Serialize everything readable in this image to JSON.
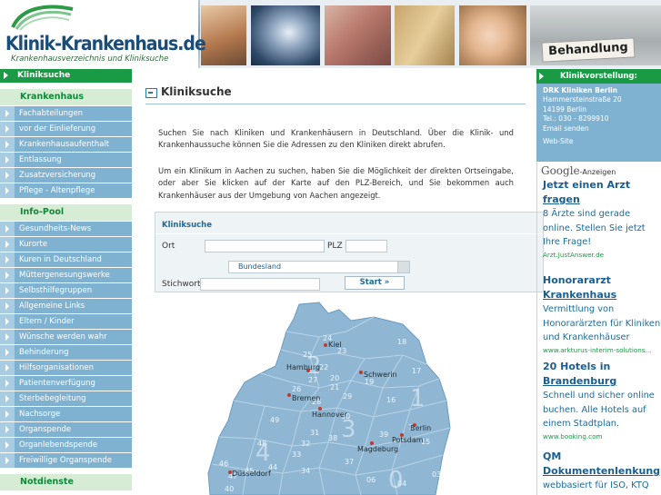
{
  "header": {
    "logo_title": "Klinik-Krankenhaus.de",
    "logo_subtitle": "Krankenhausverzeichnis und Kliniksuche",
    "banner_sign": "Behandlung"
  },
  "sidebar": {
    "active_item": "Kliniksuche",
    "sections": [
      {
        "title": "Krankenhaus",
        "items": [
          "Fachabteilungen",
          "vor der Einlieferung",
          "Krankenhausaufenthalt",
          "Entlassung",
          "Zusatzversicherung",
          "Pflege - Altenpflege"
        ]
      },
      {
        "title": "Info-Pool",
        "items": [
          "Gesundheits-News",
          "Kurorte",
          "Kuren in Deutschland",
          "Müttergenesungswerke",
          "Selbsthilfegruppen",
          "Allgemeine Links",
          "Eltern / Kinder",
          "Wünsche werden wahr",
          "Behinderung",
          "Hilfsorganisationen",
          "Patientenverfügung",
          "Sterbebegleitung",
          "Nachsorge",
          "Organspende",
          "Organlebendspende",
          "Freiwillige Organspende"
        ]
      },
      {
        "title": "Notdienste",
        "items": []
      }
    ]
  },
  "main": {
    "title": "Kliniksuche",
    "intro1": "Suchen Sie nach Kliniken und Krankenhäusern in Deutschland. Über die Klinik- und Krankenhaussuche können Sie die Adressen zu den Kliniken direkt abrufen.",
    "intro2": "Um ein Klinikum in Aachen zu suchen, haben Sie die Möglichkeit der direkten Ortseingabe, oder aber Sie klicken auf der Karte auf den PLZ-Bereich, und Sie bekommen auch Krankenhäuser aus der Umgebung von Aachen angezeigt.",
    "search": {
      "box_title": "Kliniksuche",
      "ort_label": "Ort",
      "plz_label": "PLZ",
      "bundesland_value": "Bundesland",
      "stichwort_label": "Stichwort",
      "start_button": "Start »"
    },
    "map": {
      "cities": [
        "Kiel",
        "Hamburg",
        "Schwerin",
        "Bremen",
        "Hannover",
        "Berlin",
        "Potsdam",
        "Magdeburg",
        "Düsseldorf"
      ],
      "plz_numbers": [
        "24",
        "23",
        "18",
        "25",
        "22",
        "19",
        "17",
        "21",
        "26",
        "27",
        "20",
        "28",
        "16",
        "29",
        "49",
        "30",
        "39",
        "14",
        "48",
        "32",
        "38",
        "31",
        "15",
        "33",
        "46",
        "47",
        "44",
        "45",
        "34",
        "37",
        "06",
        "04",
        "03",
        "40",
        "1",
        "2",
        "3",
        "4",
        "0"
      ]
    }
  },
  "right": {
    "kv_title": "Klinikvorstellung:",
    "kv_name": "DRK Kliniken Berlin",
    "kv_street": "Hammersteinstraße 20",
    "kv_city": "14199 Berlin",
    "kv_tel": "Tel.: 030 - 8299910",
    "kv_email": "Email senden",
    "kv_web": "Web-Site",
    "google_brand": "Google",
    "google_label": "-Anzeigen",
    "ads": [
      {
        "h1": "Jetzt einen Arzt",
        "h2": "fragen",
        "body": "8 Ärzte sind gerade online. Stellen Sie jetzt Ihre Frage!",
        "url": "Arzt.JustAnswer.de"
      },
      {
        "h1": "Honorararzt",
        "h2": "Krankenhaus",
        "body": "Vermittlung von Honorarärzten für Kliniken und Krankenhäuser",
        "url": "www.arkturus-interim-solutions..."
      },
      {
        "h1": "20 Hotels in",
        "h2": "Brandenburg",
        "body": "Schnell und sicher online buchen. Alle Hotels auf einem Stadtplan.",
        "url": "www.booking.com"
      },
      {
        "h1": "QM",
        "h2": "Dokumentenlenkung",
        "body": "webbasiert für ISO, KTQ",
        "url": ""
      }
    ]
  }
}
